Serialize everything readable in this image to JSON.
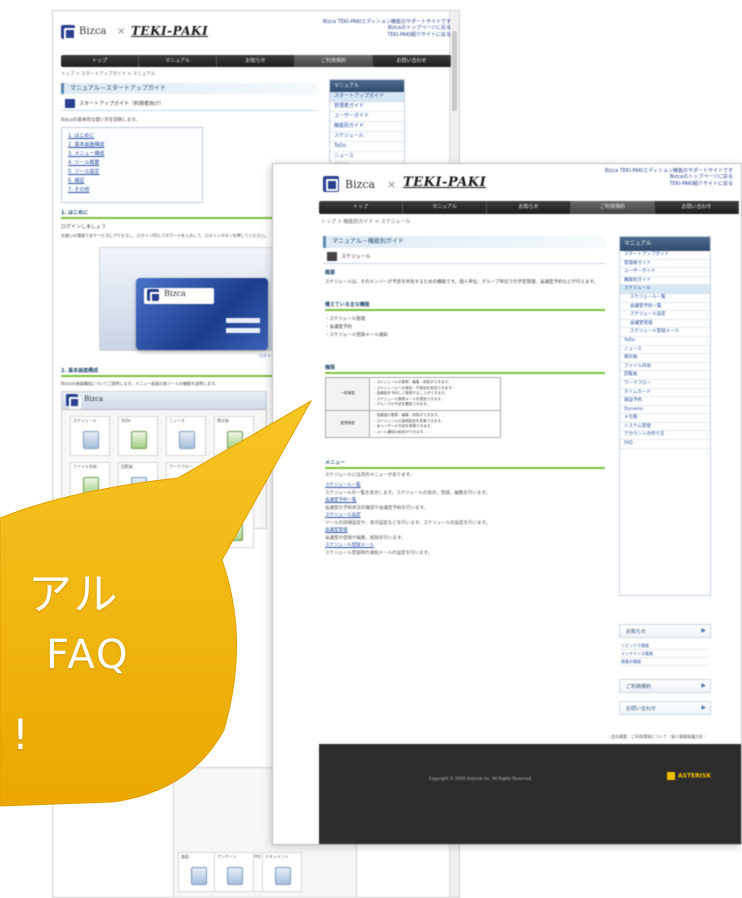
{
  "header": {
    "brand": "Bizca",
    "separator": "×",
    "partner": "TEKI-PAKI",
    "front_tagline": "Bizca TEKI-PAKIエディション機能のサポートサイトです",
    "front_links": [
      "Bizcaのトップページに戻る",
      "TEKI-PAKI紹介サイトに戻る"
    ],
    "back_tagline": "Bizca TEKI-PAKIエディション機能のサポートサイトです",
    "back_links": [
      "Bizcaのトップページに戻る",
      "TEKI-PAKI紹介サイトに戻る"
    ]
  },
  "nav": [
    "トップ",
    "マニュアル",
    "お知らせ",
    "ご利用規約",
    "お問い合わせ"
  ],
  "back": {
    "breadcrumb": "トップ > スタートアップガイド > マニュアル",
    "title": "マニュアル－スタートアップガイド",
    "subtitle": "スタートアップガイド（利用者向け）",
    "intro": "Bizcaの基本的な使い方を説明します。",
    "toc": [
      "1. はじめに",
      "2. 基本画面構成",
      "3. メニュー構成",
      "4. ツール概要",
      "5. ツール設定",
      "6. 補足",
      "7. その他"
    ],
    "section1": "1. はじめに",
    "section1_text": "ログインしましょう",
    "section1_body": "お使いの環境で本サービスにアクセスし、ログインIDとパスワードを入力して、ログインボタンを押してください。",
    "login_caption": "ログイン画面",
    "section2": "2. 基本画面構成",
    "section2_body": "Bizcaの画面構成についてご説明します。メニュー画面の各ツールの機能を説明します。",
    "tiles": [
      "スケジュール",
      "ToDo",
      "ニュース",
      "掲示板",
      "ファイル共有",
      "回覧板",
      "ワークフロー",
      "タイムカード",
      "施設予約",
      "Dynamo",
      "メモ帳",
      "アンケート"
    ],
    "tiles2": [
      "施設",
      "Dynamo",
      "FAQ",
      "アンケート",
      "ドキュメント"
    ],
    "menu_title": "マニュアル",
    "menu_items": [
      "スタートアップガイド",
      "管理者ガイド",
      "ユーザーガイド",
      "機能別ガイド",
      "スケジュール",
      "ToDo",
      "ニュース",
      "掲示板",
      "ファイル共有"
    ]
  },
  "front": {
    "breadcrumb": "トップ > 機能別ガイド > スケジュール",
    "title": "マニュアル－機能別ガイド",
    "subtitle": "スケジュール",
    "overview_head": "概要",
    "overview_body": "スケジュールは、そのメンバーが予定を共有するための機能です。個人単位、グループ単位での予定管理、会議室予約などが行えます。",
    "features_head": "備えている主な機能",
    "features": [
      "・スケジュール管理",
      "・会議室予約",
      "・スケジュール登録メール通知"
    ],
    "perm_head": "権限",
    "perm_rows": [
      {
        "label": "一般権限",
        "lines": [
          "・スケジュールの登録・編集・削除ができます。",
          "・スケジュールへの参加・不参加を設定できます。",
          "・会議室を予約して登録することができます。",
          "・スケジュール登録メールを受信できます。",
          "・グループの予定を閲覧できます。"
        ]
      },
      {
        "label": "管理権限",
        "lines": [
          "・会議室の登録・編集・削除ができます。",
          "・スケジュールの運用設定を変更できます。",
          "・全ユーザーの予定を参照できます。",
          "・メール通知の設定ができます。"
        ]
      }
    ],
    "menu_head": "メニュー",
    "menu_intro": "スケジュールには次のメニューがあります。",
    "menu_links": [
      {
        "link": "スケジュール一覧",
        "desc": "スケジュールの一覧を表示します。スケジュールの表示、登録、編集を行います。"
      },
      {
        "link": "会議室予約一覧",
        "desc": "会議室の予約状況の確認や会議室予約を行います。"
      },
      {
        "link": "スケジュール設定",
        "desc": "ツールの詳細設定や、表示設定などを行います。スケジュールの設定を行います。"
      },
      {
        "link": "会議室管理",
        "desc": "会議室の登録や編集、削除を行います。"
      },
      {
        "link": "スケジュール登録メール",
        "desc": "スケジュール登録時の通知メールの設定を行います。"
      }
    ],
    "footer_links": "｜会社概要｜ご利用環境について｜個人情報保護方針｜",
    "copyright": "Copyright © 2009 Asterisk Inc. All Rights Reserved.",
    "footer_brand": "ASTERISK",
    "side_menu_title": "マニュアル",
    "side_menu": [
      "スタートアップガイド",
      "管理者ガイド",
      "ユーザーガイド",
      "機能別ガイド",
      "スケジュール",
      "スケジュール一覧",
      "会議室予約一覧",
      "スケジュール設定",
      "会議室管理",
      "スケジュール登録メール",
      "ToDo",
      "ニュース",
      "掲示板",
      "ファイル共有",
      "回覧板",
      "ワークフロー",
      "タイムカード",
      "施設予約",
      "Dynamo",
      "メモ帳",
      "システム管理",
      "アカウントの作り方",
      "FAQ"
    ],
    "side_menu2": [
      "スケジュール",
      "ToDo",
      "ニュース",
      "掲示板",
      "ファイル共有",
      "回覧板",
      "ワークフロー",
      "タイムカード",
      "施設予約",
      "Dynamo",
      "システム管理",
      "アカウントの作り方",
      "その他"
    ],
    "side_boxes": [
      "お知らせ",
      "ご利用規約",
      "お問い合わせ"
    ],
    "news_items": [
      "トピックス情報",
      "メンテナンス情報",
      "障害の情報"
    ]
  },
  "bubble": {
    "lines": [
      "アル",
      "FAQ",
      "!"
    ],
    "color": "#f2b705"
  }
}
